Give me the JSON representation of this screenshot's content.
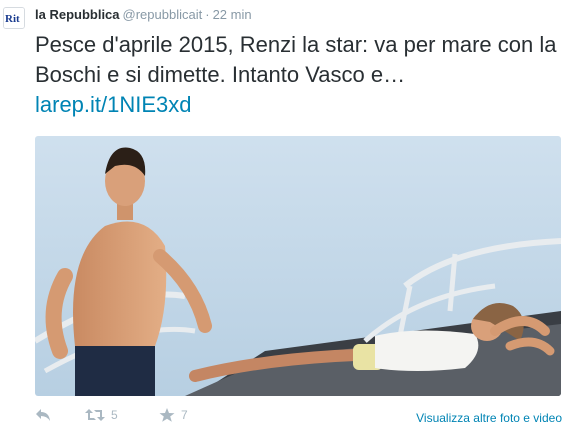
{
  "tweet": {
    "avatar_text": "Rit",
    "author_name": "la Repubblica",
    "author_handle": "@repubblicait",
    "separator": "·",
    "timestamp": "22 min",
    "text": "Pesce d'aprile 2015, Renzi la star: va per mare con la Boschi e si dimette. Intanto Vasco e…",
    "link": "larep.it/1NIE3xd",
    "retweet_count": "5",
    "favorite_count": "7",
    "media_link_label": "Visualizza altre foto e video"
  },
  "icons": {
    "reply": "reply-icon",
    "retweet": "retweet-icon",
    "favorite": "star-icon"
  },
  "colors": {
    "link": "#0084b4",
    "muted": "#8899a6",
    "text": "#292f33",
    "brand": "#1a3c8f"
  }
}
